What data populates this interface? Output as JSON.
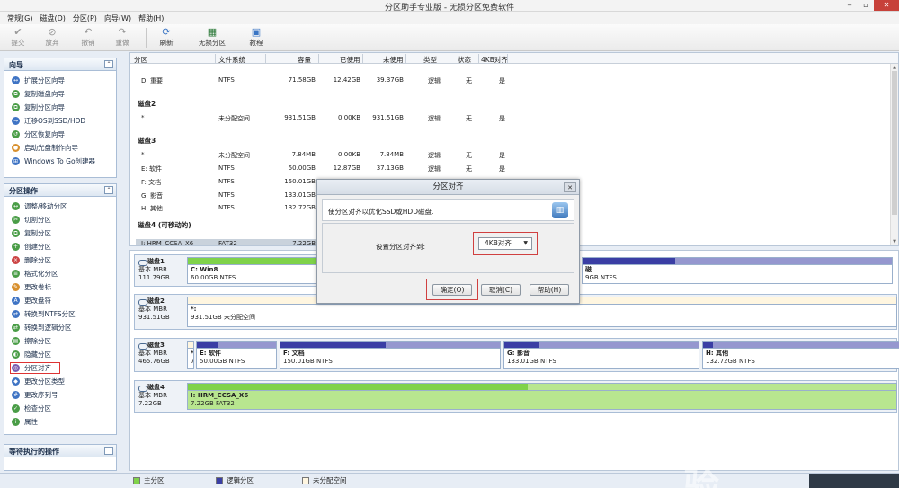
{
  "window": {
    "title": "分区助手专业版 - 无损分区免费软件",
    "controls": [
      "‒",
      "▫",
      "✕"
    ]
  },
  "menu": [
    {
      "name": "menu-general",
      "label": "常规(G)"
    },
    {
      "name": "menu-disk",
      "label": "磁盘(D)"
    },
    {
      "name": "menu-partition",
      "label": "分区(P)"
    },
    {
      "name": "menu-wizard",
      "label": "向导(W)"
    },
    {
      "name": "menu-help",
      "label": "帮助(H)"
    }
  ],
  "toolbar": {
    "commit": {
      "label": "提交",
      "icon": "check-icon"
    },
    "discard": {
      "label": "放弃",
      "icon": "discard-icon"
    },
    "undo": {
      "label": "撤销",
      "icon": "undo-icon"
    },
    "redo": {
      "label": "重做",
      "icon": "redo-icon"
    },
    "refresh": {
      "label": "刷新",
      "icon": "refresh-icon"
    },
    "lossless": {
      "label": "无损分区",
      "icon": "partition-icon"
    },
    "tutorial": {
      "label": "教程",
      "icon": "tutorial-icon"
    }
  },
  "wizard_panel": {
    "title": "向导",
    "items": [
      {
        "label": "扩展分区向导",
        "icon": "expand-icon"
      },
      {
        "label": "复制磁盘向导",
        "icon": "copy-disk-icon"
      },
      {
        "label": "复制分区向导",
        "icon": "copy-partition-icon"
      },
      {
        "label": "迁移OS到SSD/HDD",
        "icon": "migrate-icon"
      },
      {
        "label": "分区恢复向导",
        "icon": "recover-icon"
      },
      {
        "label": "启动光盘制作向导",
        "icon": "boot-disc-icon"
      },
      {
        "label": "Windows To Go创建器",
        "icon": "windows-icon"
      }
    ]
  },
  "ops_panel": {
    "title": "分区操作",
    "items": [
      {
        "label": "调整/移动分区",
        "icon": "resize-icon"
      },
      {
        "label": "切割分区",
        "icon": "split-icon"
      },
      {
        "label": "复制分区",
        "icon": "copy-icon"
      },
      {
        "label": "创建分区",
        "icon": "create-icon"
      },
      {
        "label": "删除分区",
        "icon": "delete-icon"
      },
      {
        "label": "格式化分区",
        "icon": "format-icon"
      },
      {
        "label": "更改卷标",
        "icon": "label-icon"
      },
      {
        "label": "更改盘符",
        "icon": "drive-letter-icon"
      },
      {
        "label": "转换到NTFS分区",
        "icon": "convert-ntfs-icon"
      },
      {
        "label": "转换到逻辑分区",
        "icon": "convert-logical-icon"
      },
      {
        "label": "擦除分区",
        "icon": "wipe-icon"
      },
      {
        "label": "隐藏分区",
        "icon": "hide-icon"
      },
      {
        "label": "分区对齐",
        "icon": "align-icon"
      },
      {
        "label": "更改分区类型",
        "icon": "change-type-icon"
      },
      {
        "label": "更改序列号",
        "icon": "serial-icon"
      },
      {
        "label": "检查分区",
        "icon": "check-icon"
      },
      {
        "label": "属性",
        "icon": "properties-icon"
      }
    ]
  },
  "pending_panel": {
    "title": "等待执行的操作"
  },
  "table": {
    "headers": [
      "分区",
      "文件系统",
      "容量",
      "已使用",
      "未使用",
      "类型",
      "状态",
      "4KB对齐"
    ],
    "rows": [
      {
        "kind": "part",
        "cells": [
          "D: 重要",
          "NTFS",
          "71.58GB",
          "12.42GB",
          "39.37GB",
          "逻辑",
          "无",
          "是"
        ]
      },
      {
        "kind": "disk",
        "label": "磁盘2"
      },
      {
        "kind": "part",
        "cells": [
          "*",
          "未分配空间",
          "931.51GB",
          "0.00KB",
          "931.51GB",
          "逻辑",
          "无",
          "是"
        ]
      },
      {
        "kind": "disk",
        "label": "磁盘3"
      },
      {
        "kind": "part",
        "cells": [
          "*",
          "未分配空间",
          "7.84MB",
          "0.00KB",
          "7.84MB",
          "逻辑",
          "无",
          "是"
        ]
      },
      {
        "kind": "part",
        "cells": [
          "E: 软件",
          "NTFS",
          "50.00GB",
          "12.87GB",
          "37.13GB",
          "逻辑",
          "无",
          "是"
        ]
      },
      {
        "kind": "part",
        "cells": [
          "F: 文档",
          "NTFS",
          "150.01GB",
          "",
          "",
          "",
          "",
          ""
        ]
      },
      {
        "kind": "part",
        "cells": [
          "G: 影音",
          "NTFS",
          "133.01GB",
          "",
          "",
          "",
          "",
          ""
        ]
      },
      {
        "kind": "part",
        "cells": [
          "H: 其他",
          "NTFS",
          "132.72GB",
          "",
          "",
          "",
          "",
          ""
        ]
      },
      {
        "kind": "disk",
        "label": "磁盘4 (可移动的)"
      },
      {
        "kind": "part",
        "cells": [
          "I: HRM_CCSA_X6",
          "FAT32",
          "7.22GB",
          "",
          "",
          "",
          "",
          ""
        ]
      }
    ]
  },
  "diskmap": {
    "disks": [
      {
        "name": "磁盘1",
        "type": "基本 MBR",
        "size": "111.79GB",
        "partitions": [
          {
            "label": "C: Win8",
            "sub": "60.00GB NTFS",
            "kind": "primary",
            "used": 1.0
          },
          {
            "label": "",
            "sub": "",
            "kind": "logical",
            "used": 0.3
          }
        ]
      },
      {
        "name": "磁盘2",
        "type": "基本 MBR",
        "size": "931.51GB",
        "partitions": [
          {
            "label": "*:",
            "sub": "931.51GB 未分配空间",
            "kind": "unalloc",
            "used": 0.0
          }
        ]
      },
      {
        "name": "磁盘3",
        "type": "基本 MBR",
        "size": "465.76GB",
        "partitions": [
          {
            "label": "*",
            "sub": "7",
            "kind": "unalloc",
            "used": 0.0
          },
          {
            "label": "E: 软件",
            "sub": "50.00GB NTFS",
            "kind": "logical",
            "used": 0.26
          },
          {
            "label": "F: 文档",
            "sub": "150.01GB NTFS",
            "kind": "logical",
            "used": 0.48
          },
          {
            "label": "G: 影音",
            "sub": "133.01GB NTFS",
            "kind": "logical",
            "used": 0.18
          },
          {
            "label": "H: 其他",
            "sub": "132.72GB NTFS",
            "kind": "logical",
            "used": 0.05
          }
        ]
      },
      {
        "name": "磁盘4",
        "type": "基本 MBR",
        "size": "7.22GB",
        "partitions": [
          {
            "label": "I: HRM_CCSA_X6",
            "sub": "7.22GB FAT32",
            "kind": "primary",
            "used": 0.48
          }
        ]
      }
    ],
    "disk1_tail_label": "磁",
    "disk1_tail_sub": "9GB NTFS"
  },
  "legend": [
    {
      "label": "主分区",
      "color": "#7fd24a"
    },
    {
      "label": "逻辑分区",
      "color": "#3a3ea4"
    },
    {
      "label": "未分配空间",
      "color": "#fff6e0"
    }
  ],
  "dialog": {
    "title": "分区对齐",
    "message": "使分区对齐以优化SSD或HDD磁盘.",
    "setting_label": "设置分区对齐到:",
    "selected_option": "4KB对齐",
    "ok_label": "确定(O)",
    "cancel_label": "取消(C)",
    "help_label": "帮助(H)"
  },
  "watermark": {
    "main": "Bai du 经验",
    "sub": "jingyan.baidu.com"
  },
  "colors": {
    "primary": "#7fd24a",
    "logical": "#3a3ea4",
    "unalloc": "#fff6e0",
    "highlight": "#d04040"
  }
}
